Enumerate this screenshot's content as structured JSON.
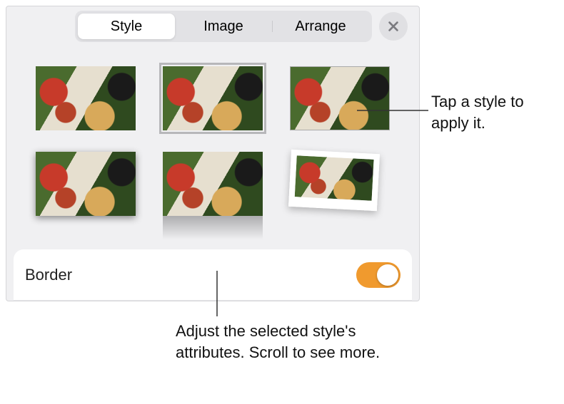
{
  "tabs": {
    "items": [
      {
        "label": "Style"
      },
      {
        "label": "Image"
      },
      {
        "label": "Arrange"
      }
    ],
    "active_index": 0
  },
  "close_icon": "x",
  "style_grid": {
    "items": [
      {
        "variant": "plain"
      },
      {
        "variant": "selected"
      },
      {
        "variant": "thinframe"
      },
      {
        "variant": "shadow"
      },
      {
        "variant": "reflection"
      },
      {
        "variant": "polaroid"
      }
    ]
  },
  "border_section": {
    "label": "Border",
    "toggle_on": true
  },
  "callouts": {
    "style": "Tap a style to apply it.",
    "attributes": "Adjust the selected style's attributes. Scroll to see more."
  }
}
